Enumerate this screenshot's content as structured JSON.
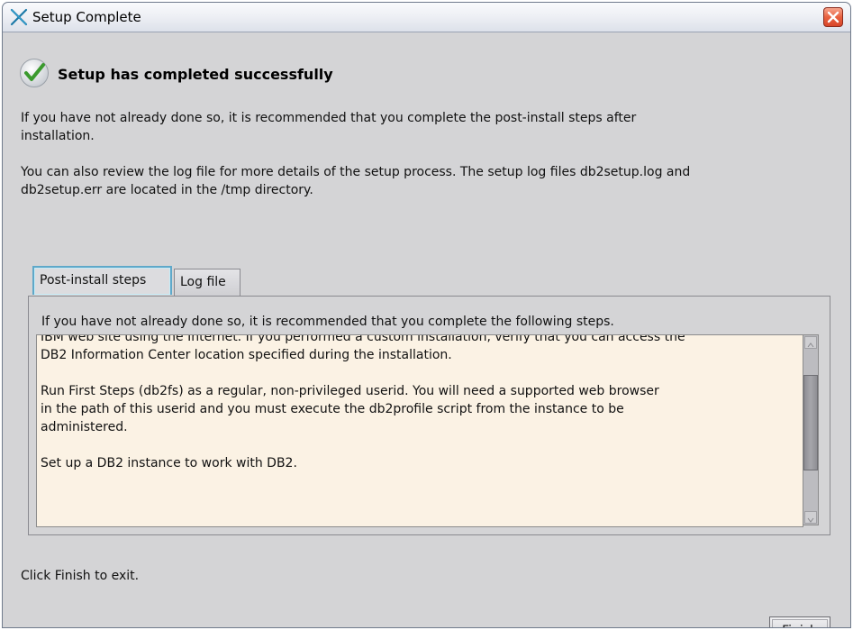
{
  "window": {
    "title": "Setup Complete"
  },
  "heading": "Setup has completed successfully",
  "intro": {
    "line1": "If you have not already done so, it is recommended that you complete the post-install steps after",
    "line2": "installation.",
    "line3": "You can also review the log file for more details of the setup process. The setup log files db2setup.log and",
    "line4": "db2setup.err are located in the /tmp directory."
  },
  "tabs": [
    {
      "label": "Post-install steps",
      "selected": true
    },
    {
      "label": "Log file",
      "selected": false
    }
  ],
  "panel": {
    "intro": "If you have not already done so, it is recommended that you complete the following steps.",
    "lines": [
      "IBM web site using the Internet. If you performed a custom installation, verify that you can access the",
      "DB2 Information Center location specified during the installation.",
      "",
      "Run First Steps (db2fs) as a regular, non-privileged userid.  You will need a supported web browser",
      "in the path of this userid and you must execute the db2profile script from the instance to be",
      "administered.",
      "",
      "Set up a DB2 instance to work with DB2."
    ]
  },
  "footer": {
    "message": "Click Finish to exit.",
    "finish_mnemonic": "F",
    "finish_rest": "inish"
  },
  "colors": {
    "tab_focus": "#5fa8c9",
    "text_area_bg": "#fbf2e4",
    "window_bg": "#d4d4d6"
  },
  "icons": {
    "app": "x-logo-icon",
    "close": "close-icon",
    "success": "checkmark-icon"
  }
}
